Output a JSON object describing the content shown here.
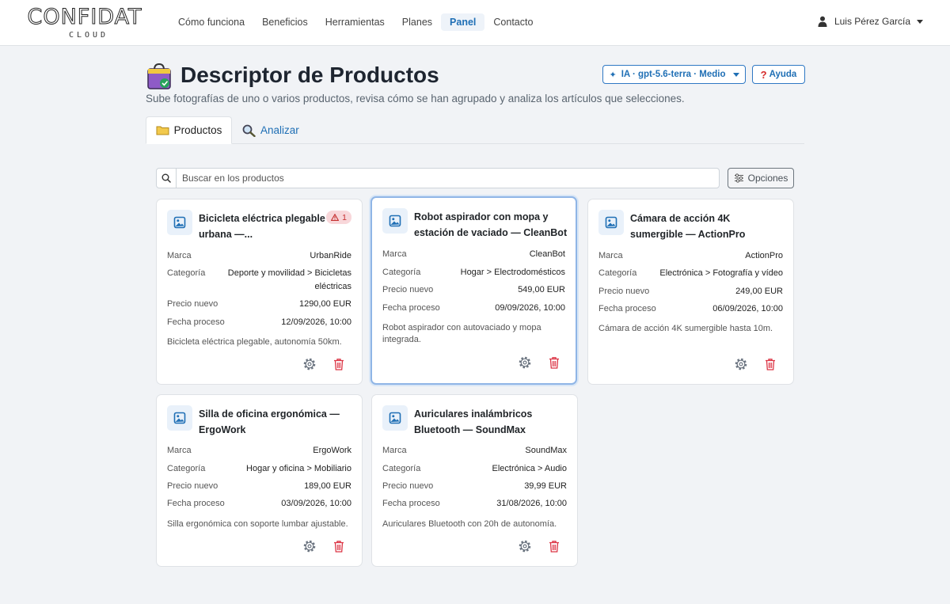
{
  "brand": {
    "name": "CONFIDAT",
    "sub": "CLOUD"
  },
  "nav": [
    "Cómo funciona",
    "Beneficios",
    "Herramientas",
    "Planes",
    "Panel",
    "Contacto"
  ],
  "nav_active": "Panel",
  "user": {
    "name": "Luis Pérez García"
  },
  "header": {
    "title": "Descriptor de Productos",
    "subtitle": "Sube fotografías de uno o varios productos, revisa cómo se han agrupado y analiza los artículos que selecciones.",
    "ai_button": "IA · gpt-5.6-terra · Medio",
    "help_button": "Ayuda"
  },
  "tabs": {
    "products": "Productos",
    "analyze": "Analizar"
  },
  "search": {
    "placeholder": "Buscar en los productos"
  },
  "options_button": "Opciones",
  "labels": {
    "brand": "Marca",
    "category": "Categoría",
    "price": "Precio nuevo",
    "date": "Fecha proceso"
  },
  "products": [
    {
      "title": "Bicicleta eléctrica plegable urbana —...",
      "brand": "UrbanRide",
      "category": "Deporte y movilidad > Bicicletas eléctricas",
      "price": "1290,00 EUR",
      "date": "12/09/2026, 10:00",
      "description": "Bicicleta eléctrica plegable, autonomía 50km.",
      "warnings": "1"
    },
    {
      "title": "Robot aspirador con mopa y estación de vaciado — CleanBot",
      "brand": "CleanBot",
      "category": "Hogar > Electrodomésticos",
      "price": "549,00 EUR",
      "date": "09/09/2026, 10:00",
      "description": "Robot aspirador con autovaciado y mopa integrada.",
      "selected": true
    },
    {
      "title": "Cámara de acción 4K sumergible — ActionPro",
      "brand": "ActionPro",
      "category": "Electrónica > Fotografía y vídeo",
      "price": "249,00 EUR",
      "date": "06/09/2026, 10:00",
      "description": "Cámara de acción 4K sumergible hasta 10m."
    },
    {
      "title": "Silla de oficina ergonómica — ErgoWork",
      "brand": "ErgoWork",
      "category": "Hogar y oficina > Mobiliario",
      "price": "189,00 EUR",
      "date": "03/09/2026, 10:00",
      "description": "Silla ergonómica con soporte lumbar ajustable."
    },
    {
      "title": "Auriculares inalámbricos Bluetooth — SoundMax",
      "brand": "SoundMax",
      "category": "Electrónica > Audio",
      "price": "39,99 EUR",
      "date": "31/08/2026, 10:00",
      "description": "Auriculares Bluetooth con 20h de autonomía."
    }
  ],
  "colors": {
    "accent": "#1f6fb5",
    "danger": "#dc3545",
    "background": "#f1f3f6"
  }
}
